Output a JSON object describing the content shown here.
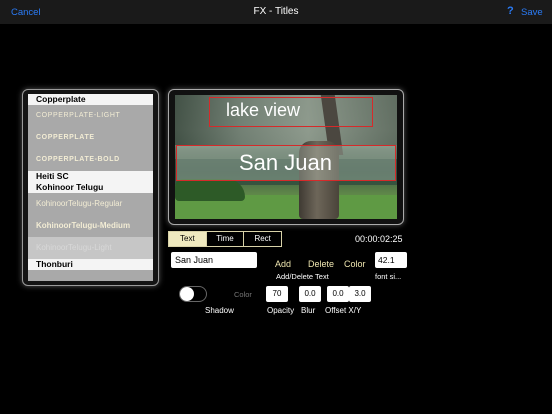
{
  "navbar": {
    "cancel": "Cancel",
    "title": "FX - Titles",
    "help": "?",
    "save": "Save"
  },
  "font_list": {
    "items": [
      {
        "label": "Copperplate",
        "kind": "title"
      },
      {
        "label": "Copperplate-Light",
        "kind": "sub"
      },
      {
        "label": "Copperplate",
        "kind": "sub"
      },
      {
        "label": "Copperplate-Bold",
        "kind": "sub-bold"
      },
      {
        "label": "Heiti SC",
        "kind": "title"
      },
      {
        "label": "Kohinoor Telugu",
        "kind": "title"
      },
      {
        "label": "KohinoorTelugu-Regular",
        "kind": "sub-plain"
      },
      {
        "label": "KohinoorTelugu-Medium",
        "kind": "sub-plain-bold"
      },
      {
        "label": "KohinoorTelugu-Light",
        "kind": "sub-selected"
      },
      {
        "label": "Thonburi",
        "kind": "title"
      }
    ]
  },
  "preview": {
    "title1": "lake view",
    "title2": "San Juan"
  },
  "segments": {
    "items": [
      "Text",
      "Time",
      "Rect"
    ],
    "active": "Text"
  },
  "timecode": "00:00:02:25",
  "text_field": {
    "value": "San Juan"
  },
  "actions": {
    "add": "Add",
    "delete": "Delete",
    "color": "Color",
    "add_delete_label": "Add/Delete Text"
  },
  "font_size": {
    "value": "42.1",
    "label": "font si..."
  },
  "shadow": {
    "label": "Shadow",
    "enabled": false,
    "color_label": "Color",
    "opacity": "70",
    "opacity_label": "Opacity",
    "blur": "0.0",
    "blur_label": "Blur",
    "offset_x": "0.0",
    "offset_y": "3.0",
    "offset_label": "Offset X/Y"
  },
  "colors": {
    "accent": "#2a7bf6",
    "highlight": "#efe6b0",
    "border_red": "#d62a2a"
  }
}
